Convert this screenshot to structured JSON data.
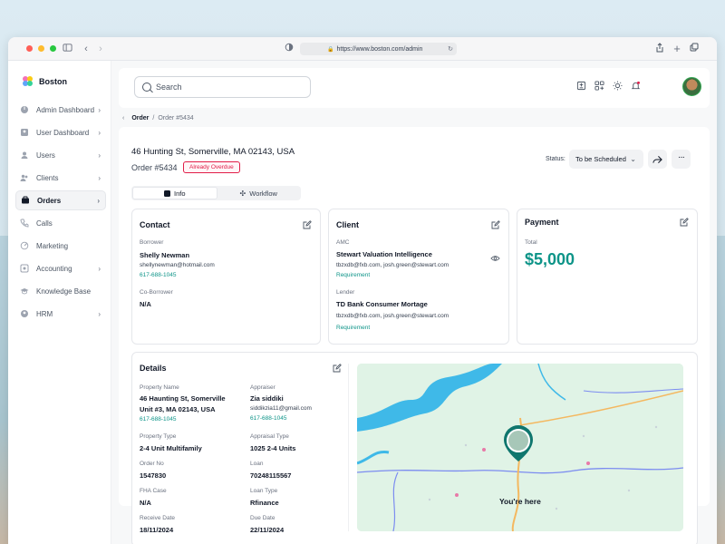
{
  "browser": {
    "url": "https://www.boston.com/admin"
  },
  "sidebar": {
    "brand": "Boston",
    "items": [
      {
        "label": "Admin Dashboard",
        "icon": "dashboard-icon",
        "chevron": true,
        "active": false
      },
      {
        "label": "User Dashboard",
        "icon": "user-dashboard-icon",
        "chevron": true,
        "active": false
      },
      {
        "label": "Users",
        "icon": "users-icon",
        "chevron": true,
        "active": false
      },
      {
        "label": "Clients",
        "icon": "clients-icon",
        "chevron": true,
        "active": false
      },
      {
        "label": "Orders",
        "icon": "orders-icon",
        "chevron": true,
        "active": true
      },
      {
        "label": "Calls",
        "icon": "phone-icon",
        "chevron": false,
        "active": false
      },
      {
        "label": "Marketing",
        "icon": "marketing-icon",
        "chevron": false,
        "active": false
      },
      {
        "label": "Accounting",
        "icon": "accounting-icon",
        "chevron": true,
        "active": false
      },
      {
        "label": "Knowledge Base",
        "icon": "graduation-cap-icon",
        "chevron": false,
        "active": false
      },
      {
        "label": "HRM",
        "icon": "hrm-icon",
        "chevron": true,
        "active": false
      }
    ]
  },
  "topbar": {
    "search_placeholder": "Search"
  },
  "breadcrumb": {
    "root": "Order",
    "separator": "/",
    "current": "Order #5434"
  },
  "order": {
    "address": "46 Hunting St, Somerville, MA 02143, USA",
    "number": "Order #5434",
    "badge": "Already Overdue",
    "status_label": "Status:",
    "status_value": "To be Scheduled"
  },
  "tabs": [
    {
      "label": "Info",
      "active": true
    },
    {
      "label": "Workflow",
      "active": false
    }
  ],
  "contact": {
    "title": "Contact",
    "borrower_label": "Borrower",
    "borrower_name": "Shelly Newman",
    "borrower_email": "shellynewman@hotmail.com",
    "borrower_phone": "617-688-1045",
    "coborrower_label": "Co-Borrower",
    "coborrower_value": "N/A"
  },
  "client": {
    "title": "Client",
    "amc_label": "AMC",
    "amc_name": "Stewart Valuation Intelligence",
    "amc_emails": "tbzxdb@fxb.com, josh.green@stewart.com",
    "amc_link": "Requirement",
    "lender_label": "Lender",
    "lender_name": "TD Bank Consumer Mortage",
    "lender_emails": "tbzxdb@fxb.com, josh.green@stewart.com",
    "lender_link": "Requirement"
  },
  "payment": {
    "title": "Payment",
    "total_label": "Total",
    "total_value": "$5,000"
  },
  "details": {
    "title": "Details",
    "property_name_label": "Property Name",
    "property_name_line1": "46 Haunting St, Somerville",
    "property_name_line2": "Unit #3, MA 02143, USA",
    "property_phone": "617-688-1045",
    "appraiser_label": "Appraiser",
    "appraiser_name": "Zia siddiki",
    "appraiser_email": "siddikzia11@gmail.com",
    "appraiser_phone": "617-688-1045",
    "property_type_label": "Property Type",
    "property_type_value": "2-4 Unit Multifamily",
    "appraisal_type_label": "Appraisal Type",
    "appraisal_type_value": "1025 2-4 Units",
    "order_no_label": "Order No",
    "order_no_value": "1547830",
    "loan_label": "Loan",
    "loan_value": "70248115567",
    "fha_label": "FHA Case",
    "fha_value": "N/A",
    "loan_type_label": "Loan Type",
    "loan_type_value": "Rfinance",
    "receive_date_label": "Receive Date",
    "receive_date_value": "18/11/2024",
    "due_date_label": "Due Date",
    "due_date_value": "22/11/2024"
  },
  "map": {
    "marker_label": "You're here"
  },
  "colors": {
    "accent": "#0d9488",
    "overdue": "#e11d48",
    "map_land": "#dff3e7",
    "map_water": "#3fb9e8"
  }
}
